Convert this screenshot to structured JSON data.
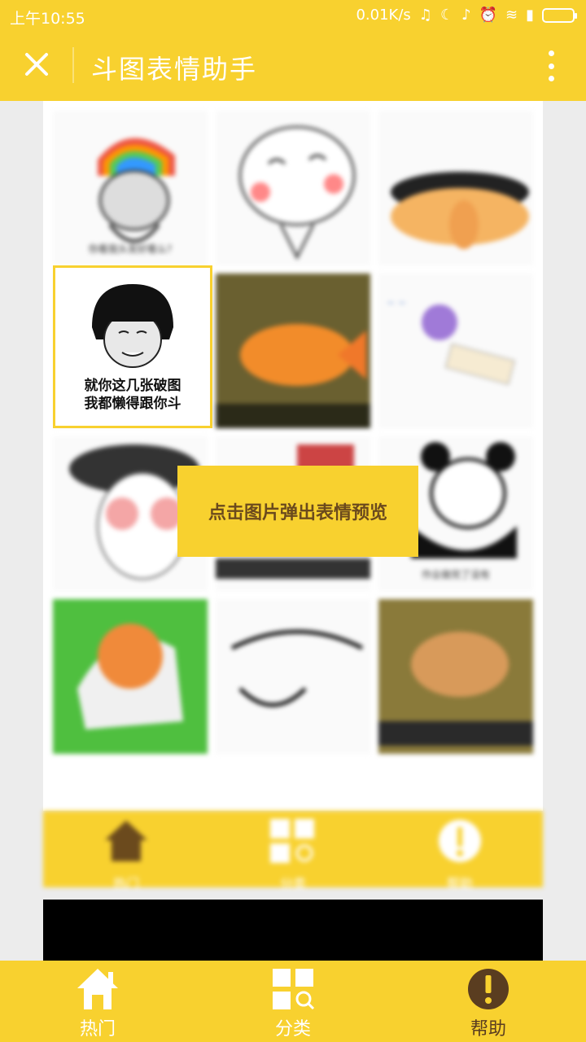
{
  "status_bar": {
    "time": "上午10:55",
    "speed": "0.01K/s"
  },
  "header": {
    "title": "斗图表情助手"
  },
  "selected_emoji": {
    "caption_line1": "就你这几张破图",
    "caption_line2": "我都懒得跟你斗"
  },
  "toast": {
    "text": "点击图片弹出表情预览"
  },
  "grid_cells": [
    {
      "caption": "你看我头发好看么?"
    },
    {
      "caption": ""
    },
    {
      "caption": ""
    },
    {
      "caption": ""
    },
    {
      "caption": ""
    },
    {
      "caption": ""
    },
    {
      "caption": ""
    },
    {
      "caption": ""
    },
    {
      "caption": "作业做完了没有"
    },
    {
      "caption": ""
    },
    {
      "caption": ""
    },
    {
      "caption": ""
    }
  ],
  "bottom_nav": {
    "items": [
      {
        "label": "热门",
        "icon": "home-icon"
      },
      {
        "label": "分类",
        "icon": "category-search-icon"
      },
      {
        "label": "帮助",
        "icon": "alert-icon"
      }
    ],
    "active_index": 2
  },
  "colors": {
    "brand": "#f8d12f",
    "active_label": "#5a3d20"
  }
}
